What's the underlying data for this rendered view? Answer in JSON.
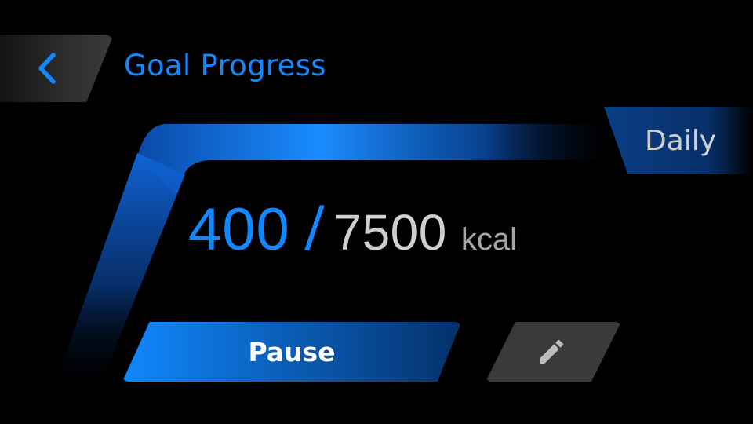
{
  "header": {
    "back_icon": "chevron-left-icon",
    "title": "Goal Progress"
  },
  "goal": {
    "period_label": "Daily",
    "current": "400",
    "separator": "/",
    "target": "7500",
    "unit": "kcal",
    "progress_fraction": 0.053
  },
  "actions": {
    "pause_label": "Pause",
    "edit_icon": "pencil-icon"
  },
  "colors": {
    "accent": "#1188ff",
    "accent_dark": "#04306a",
    "text_primary": "#ffffff",
    "text_secondary": "#cfcfcf",
    "text_muted": "#a6a6a6",
    "surface": "#3a3a3a",
    "icon_gray": "#bdbdbd",
    "background": "#000000"
  }
}
